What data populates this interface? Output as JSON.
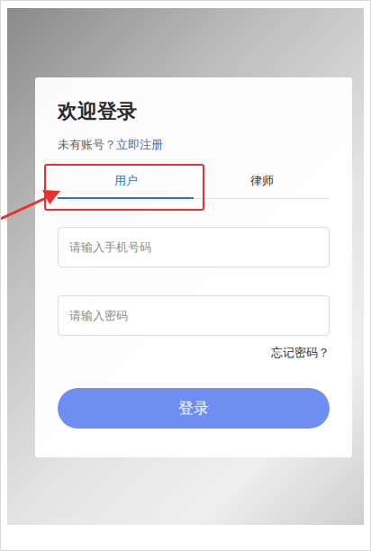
{
  "login": {
    "title": "欢迎登录",
    "register_prompt": "未有账号？",
    "register_link": "立即注册"
  },
  "tabs": [
    {
      "label": "用户",
      "selected": true
    },
    {
      "label": "律师",
      "selected": false
    }
  ],
  "fields": [
    {
      "placeholder": "请输入手机号码",
      "kind": "text"
    },
    {
      "placeholder": "请输入密码",
      "kind": "password"
    }
  ],
  "forgot_password": "忘记密码？",
  "login_button": "登录"
}
